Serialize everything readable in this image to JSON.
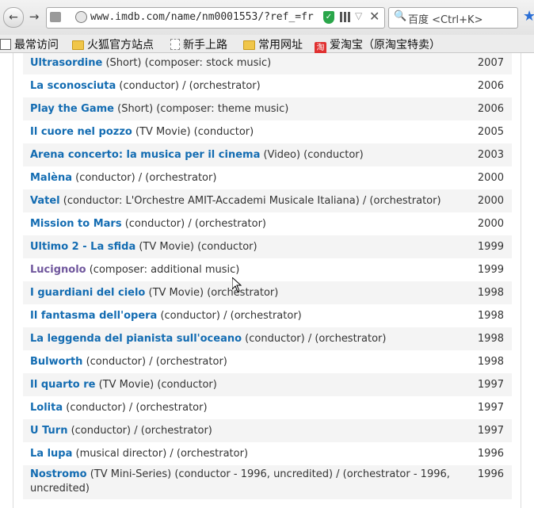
{
  "browser": {
    "url": "www.imdb.com/name/nm0001553/?ref_=fr",
    "search_placeholder": "百度 <Ctrl+K>",
    "bookmarks": [
      "最常访问",
      "火狐官方站点",
      "新手上路",
      "常用网址",
      "爱淘宝（原淘宝特卖）"
    ]
  },
  "filmography": [
    {
      "title": "Ultrasordine",
      "details": " (Short) (composer: stock music)",
      "year": "2007"
    },
    {
      "title": "La sconosciuta",
      "details": " (conductor) / (orchestrator)",
      "year": "2006"
    },
    {
      "title": "Play the Game",
      "details": " (Short) (composer: theme music)",
      "year": "2006"
    },
    {
      "title": "Il cuore nel pozzo",
      "details": " (TV Movie) (conductor)",
      "year": "2005"
    },
    {
      "title": "Arena concerto: la musica per il cinema",
      "details": " (Video) (conductor)",
      "year": "2003"
    },
    {
      "title": "Malèna",
      "details": " (conductor) / (orchestrator)",
      "year": "2000"
    },
    {
      "title": "Vatel",
      "details": " (conductor: L'Orchestre AMIT-Accademi Musicale Italiana) / (orchestrator)",
      "year": "2000"
    },
    {
      "title": "Mission to Mars",
      "details": " (conductor) / (orchestrator)",
      "year": "2000"
    },
    {
      "title": "Ultimo 2 - La sfida",
      "details": " (TV Movie) (conductor)",
      "year": "1999"
    },
    {
      "title": "Lucignolo",
      "details": " (composer: additional music)",
      "year": "1999"
    },
    {
      "title": "I guardiani del cielo",
      "details": " (TV Movie) (orchestrator)",
      "year": "1998"
    },
    {
      "title": "Il fantasma dell'opera",
      "details": " (conductor) / (orchestrator)",
      "year": "1998"
    },
    {
      "title": "La leggenda del pianista sull'oceano",
      "details": " (conductor) / (orchestrator)",
      "year": "1998"
    },
    {
      "title": "Bulworth",
      "details": " (conductor) / (orchestrator)",
      "year": "1998"
    },
    {
      "title": "Il quarto re",
      "details": " (TV Movie) (conductor)",
      "year": "1997"
    },
    {
      "title": "Lolita",
      "details": " (conductor) / (orchestrator)",
      "year": "1997"
    },
    {
      "title": "U Turn",
      "details": " (conductor) / (orchestrator)",
      "year": "1997"
    },
    {
      "title": "La lupa",
      "details": " (musical director) / (orchestrator)",
      "year": "1996"
    },
    {
      "title": "Nostromo",
      "details": " (TV Mini-Series) (conductor - 1996, uncredited) / (orchestrator - 1996, uncredited)",
      "year": "1996"
    }
  ],
  "colors": {
    "link": "#136cb2",
    "visited": "#70579d",
    "stripe": "#f4f4f4"
  }
}
